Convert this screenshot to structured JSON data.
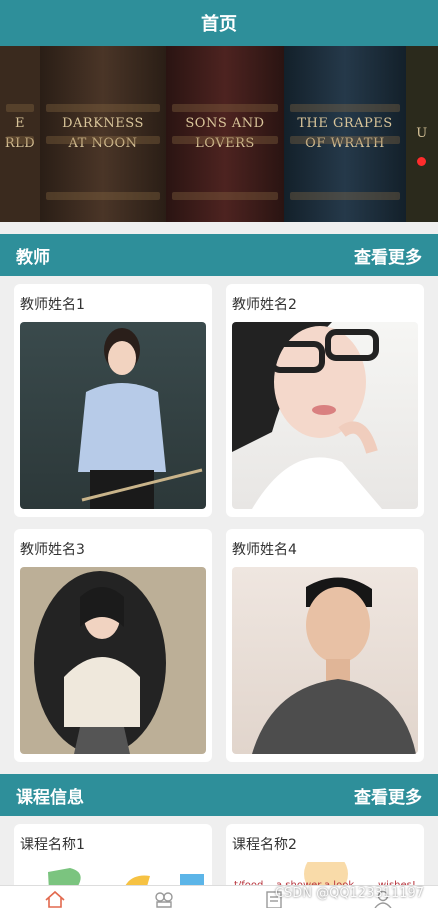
{
  "header": {
    "title": "首页"
  },
  "banner": {
    "books": [
      {
        "lines": [
          "E",
          "RLD"
        ]
      },
      {
        "lines": [
          "DARKNESS",
          "AT NOON"
        ]
      },
      {
        "lines": [
          "SONS AND",
          "LOVERS"
        ]
      },
      {
        "lines": [
          "THE GRAPES",
          "OF WRATH"
        ]
      },
      {
        "lines": [
          "U"
        ]
      }
    ],
    "dot_color": "#ff2c2c"
  },
  "teachers": {
    "title": "教师",
    "more": "查看更多",
    "items": [
      {
        "name": "教师姓名1"
      },
      {
        "name": "教师姓名2"
      },
      {
        "name": "教师姓名3"
      },
      {
        "name": "教师姓名4"
      }
    ]
  },
  "courses": {
    "title": "课程信息",
    "more": "查看更多",
    "items": [
      {
        "name": "课程名称1"
      },
      {
        "name": "课程名称2",
        "snippets": [
          "t/food",
          "a shower",
          "a look",
          "wishes!"
        ]
      }
    ]
  },
  "tabbar": {
    "icons": [
      "home-icon",
      "category-icon",
      "list-icon",
      "user-icon"
    ],
    "active_color": "#e2694e"
  },
  "watermark": "CSDN @QQ123311197",
  "colors": {
    "primary": "#2e8f9a"
  }
}
